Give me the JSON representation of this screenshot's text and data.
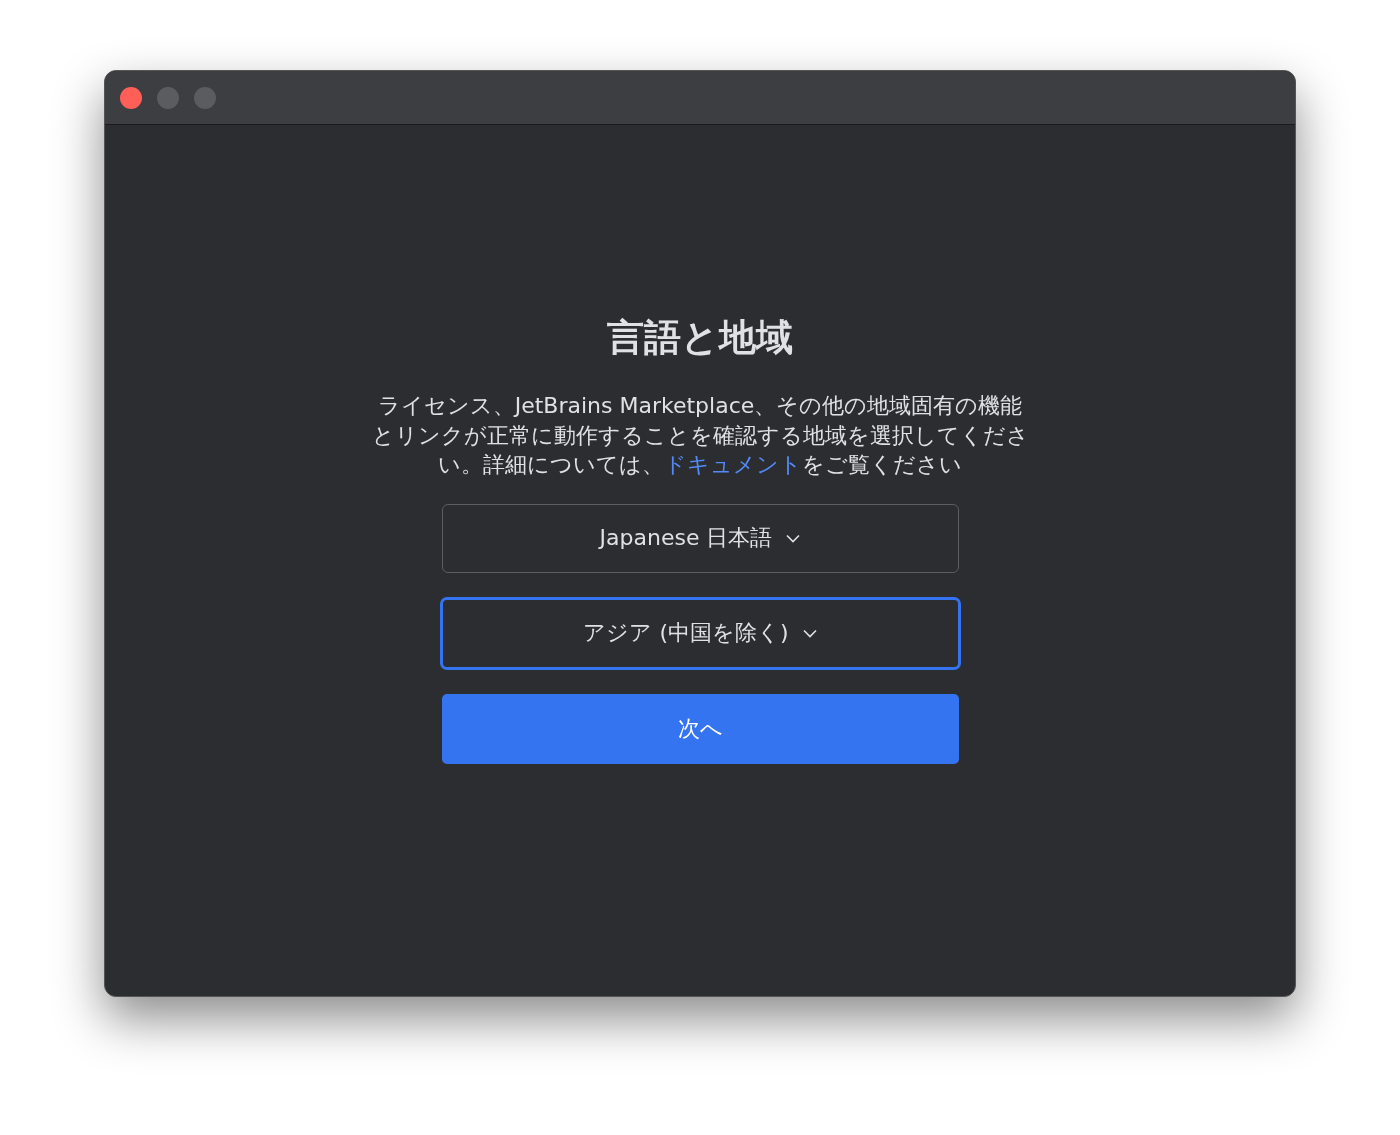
{
  "window": {
    "controls": [
      {
        "kind": "close"
      },
      {
        "kind": "minimize"
      },
      {
        "kind": "zoom"
      }
    ]
  },
  "title": "言語と地域",
  "description": {
    "before": "ライセンス、JetBrains Marketplace、その他の地域固有の機能とリンクが正常に動作することを確認する地域を選択してください。詳細については、",
    "link": "ドキュメント",
    "after": "をご覧ください"
  },
  "dropdowns": [
    {
      "value": "Japanese 日本語",
      "focused": false
    },
    {
      "value": "アジア (中国を除く)",
      "focused": true
    }
  ],
  "next_button": "次へ"
}
